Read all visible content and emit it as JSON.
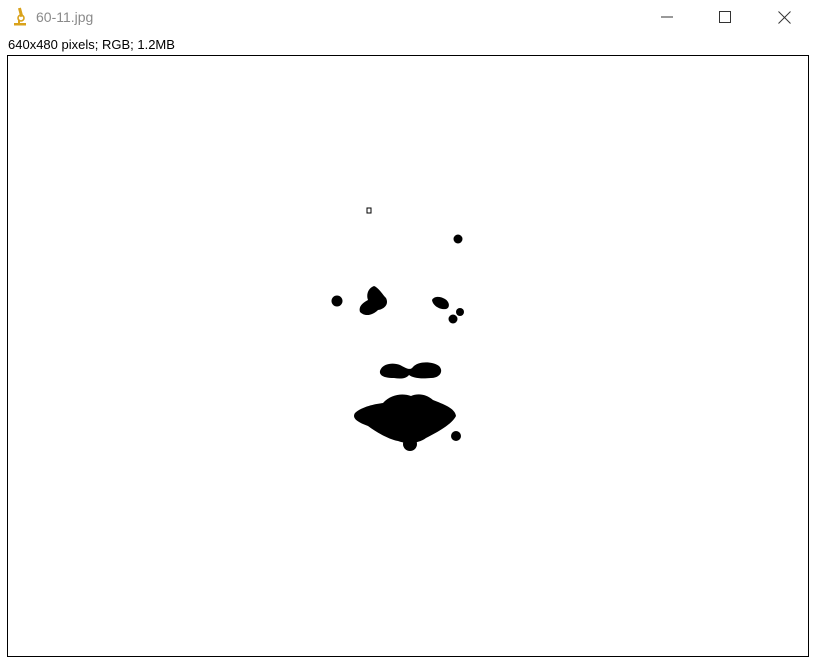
{
  "window": {
    "title": "60-11.jpg",
    "app_icon": "microscope-icon",
    "controls": {
      "minimize_icon": "minimize-icon",
      "maximize_icon": "maximize-icon",
      "close_icon": "close-icon"
    }
  },
  "image_info": "640x480 pixels; RGB; 1.2MB",
  "colors": {
    "icon_accent": "#d9a21b",
    "blob_fill": "#000000",
    "canvas_background": "#ffffff",
    "title_text": "#8a8a8a"
  }
}
